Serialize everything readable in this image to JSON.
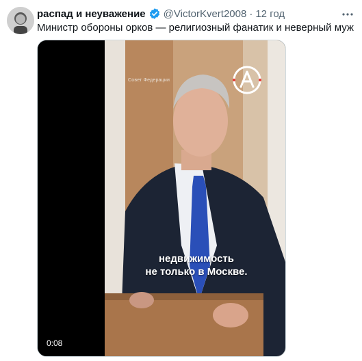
{
  "tweet": {
    "display_name": "распад и неуважение",
    "handle": "@VictorKvert2008",
    "separator": "·",
    "time": "12 год",
    "text": "Министр обороны орков — религиозный фанатик и неверный муж"
  },
  "icons": {
    "verified": "verified-badge-icon",
    "more": "more-options-icon",
    "logo": "channel-logo-icon"
  },
  "colors": {
    "verified": "#1d9bf0",
    "name": "#0f1419",
    "secondary": "#536471"
  },
  "video": {
    "source_label": "Совет Федерации",
    "caption_line1": "недвижимость",
    "caption_line2": "не только в Москве.",
    "timestamp": "0:08"
  }
}
